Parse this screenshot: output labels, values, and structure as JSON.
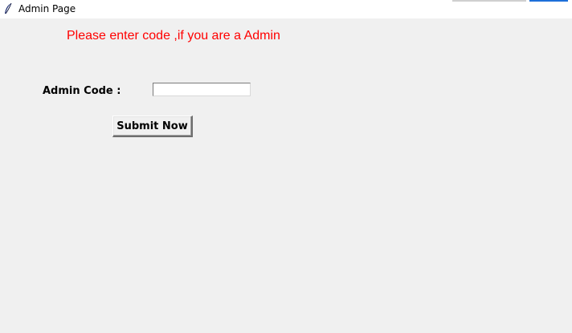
{
  "window": {
    "title": "Admin Page",
    "icon": "feather-icon"
  },
  "form": {
    "prompt": "Please enter code ,if you are a Admin",
    "code_label": "Admin Code :",
    "code_value": "",
    "submit_label": "Submit Now"
  },
  "colors": {
    "prompt_text": "#ff0000",
    "background": "#f0f0f0"
  }
}
